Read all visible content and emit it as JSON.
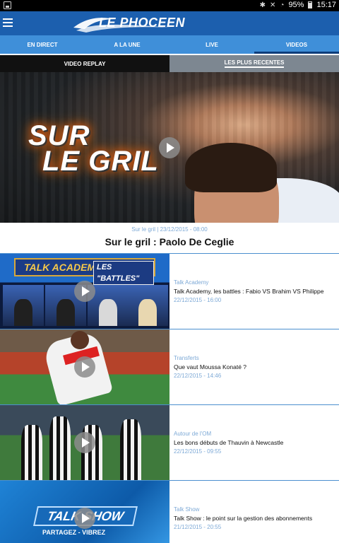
{
  "status_bar": {
    "battery": "95%",
    "time": "15:17",
    "icons": [
      "screenshot-icon",
      "bluetooth-icon",
      "mute-icon",
      "wifi-icon",
      "battery-icon"
    ]
  },
  "app_bar": {
    "logo_text": "LE PHOCEEN",
    "menu_icon": "hamburger-menu-icon"
  },
  "colors": {
    "app_bar": "#1c5fae",
    "tabs": "#3f8fd9",
    "accent_text": "#7da9d6"
  },
  "tabs": [
    {
      "label": "EN DIRECT"
    },
    {
      "label": "A LA UNE"
    },
    {
      "label": "LIVE"
    },
    {
      "label": "VIDEOS",
      "active": true
    }
  ],
  "sub_tabs": [
    {
      "label": "VIDEO REPLAY"
    },
    {
      "label": "LES PLUS RECENTES",
      "active": true
    }
  ],
  "hero": {
    "image_text": [
      "SUR",
      "LE GRIL"
    ],
    "meta": "Sur le gril | 23/12/2015 - 08:00",
    "title": "Sur le gril : Paolo De Ceglie"
  },
  "thumb_texts": {
    "talk_academy": "TALK ACADEMY",
    "battles": "LES \"BATTLES\"",
    "talk_show": "TALK SHOW",
    "tagline": "PARTAGEZ - VIBREZ"
  },
  "videos": [
    {
      "category": "Talk Academy",
      "title": "Talk Academy, les battles : Fabio VS Brahim VS Philippe",
      "date": "22/12/2015 - 16:00"
    },
    {
      "category": "Transferts",
      "title": "Que vaut Moussa Konaté ?",
      "date": "22/12/2015 - 14:46"
    },
    {
      "category": "Autour de l'OM",
      "title": "Les bons débuts de Thauvin à Newcastle",
      "date": "22/12/2015 - 09:55"
    },
    {
      "category": "Talk Show",
      "title": "Talk Show : le point sur la gestion des abonnements",
      "date": "21/12/2015 - 20:55"
    }
  ]
}
